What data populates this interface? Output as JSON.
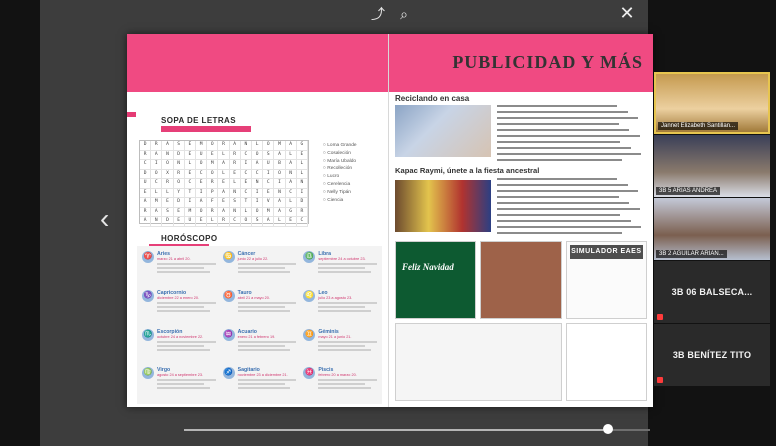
{
  "viewer": {
    "toolbar": {
      "share_icon": "share-icon",
      "zoom_icon": "zoom-icon",
      "close_icon": "close-icon",
      "prev_icon": "chevron-left-icon"
    },
    "progress": {
      "value": 0.9
    }
  },
  "magazine": {
    "left": {
      "sopa_title": "SOPA DE LETRAS",
      "words": [
        "Loma Grande",
        "Cosaleción",
        "María Ubaldo",
        "Recolleción",
        "Lucro",
        "Cerelencia",
        "Nelly Tipán",
        "Ciencia"
      ],
      "horoscope_title": "HORÓSCOPO",
      "signs": [
        {
          "name": "Aries",
          "dates": "marzo 21 a abril 20."
        },
        {
          "name": "Cáncer",
          "dates": "junio 22 a julio 22."
        },
        {
          "name": "Libra",
          "dates": "septiembre 24 a octubre 23."
        },
        {
          "name": "Capricornio",
          "dates": "diciembre 22 a enero 20."
        },
        {
          "name": "Tauro",
          "dates": "abril 21 a mayo 20."
        },
        {
          "name": "Leo",
          "dates": "julio 23 a agosto 23."
        },
        {
          "name": "Escorpión",
          "dates": "octubre 24 a noviembre 22."
        },
        {
          "name": "Acuario",
          "dates": "enero 21 a febrero 19."
        },
        {
          "name": "Géminis",
          "dates": "mayo 21 a junio 21."
        },
        {
          "name": "Virgo",
          "dates": "agosto 24 a septiembre 23."
        },
        {
          "name": "Sagitario",
          "dates": "noviembre 23 a diciembre 21."
        },
        {
          "name": "Piscis",
          "dates": "febrero 20 a marzo 20."
        }
      ]
    },
    "right": {
      "title": "PUBLICIDAD Y MÁS",
      "reciclando_title": "Reciclando en casa",
      "kapac_title": "Kapac Raymi, únete a la fiesta ancestral",
      "thumbs": {
        "feliz_navidad": "Feliz Navidad",
        "simulador": "SIMULADOR EAES"
      }
    }
  },
  "participants": [
    {
      "name": "Jannet Elizabeth Santillan...",
      "type": "video"
    },
    {
      "name": "3B 5 ARIAS ANDREA",
      "type": "video"
    },
    {
      "name": "3B 2 AGUILAR ARIAN...",
      "type": "video"
    },
    {
      "name": "3B 06 BALSECA...",
      "type": "name"
    },
    {
      "name": "3B BENÍTEZ TITO",
      "type": "name"
    }
  ]
}
